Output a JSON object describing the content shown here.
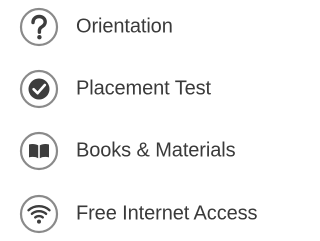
{
  "features": [
    {
      "label": "Orientation",
      "icon": "question-icon"
    },
    {
      "label": "Placement Test",
      "icon": "checkmark-icon"
    },
    {
      "label": "Books & Materials",
      "icon": "book-icon"
    },
    {
      "label": "Free Internet Access",
      "icon": "wifi-icon"
    }
  ],
  "colors": {
    "icon_ring": "#8a8a8a",
    "icon_glyph": "#3d3d3d",
    "text": "#3a3a3a"
  }
}
